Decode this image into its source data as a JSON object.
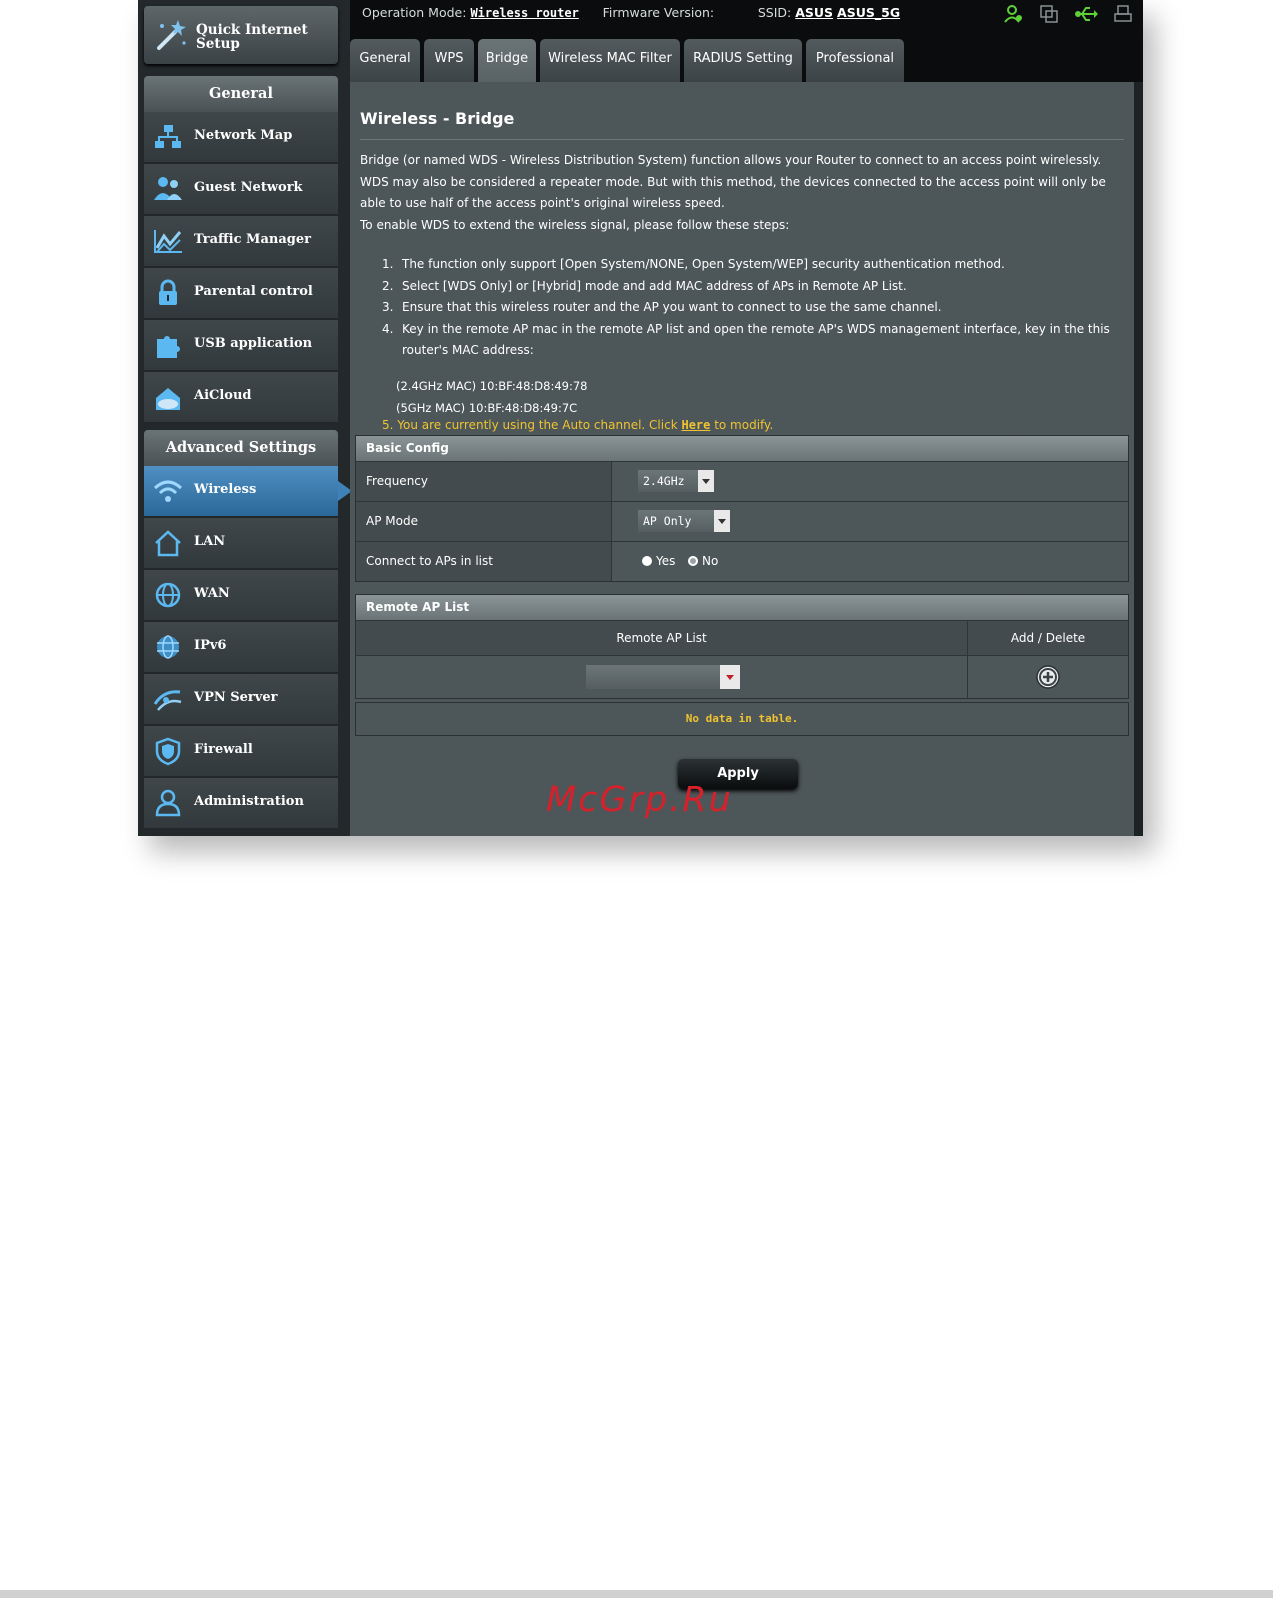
{
  "sidebar": {
    "quick_setup": "Quick Internet Setup",
    "general_header": "General",
    "general_items": [
      {
        "label": "Network Map",
        "icon": "network-map-icon"
      },
      {
        "label": "Guest Network",
        "icon": "guest-network-icon"
      },
      {
        "label": "Traffic Manager",
        "icon": "traffic-manager-icon"
      },
      {
        "label": "Parental control",
        "icon": "lock-icon"
      },
      {
        "label": "USB application",
        "icon": "puzzle-icon"
      },
      {
        "label": "AiCloud",
        "icon": "cloud-house-icon"
      }
    ],
    "advanced_header": "Advanced Settings",
    "advanced_items": [
      {
        "label": "Wireless",
        "icon": "wifi-icon",
        "active": true
      },
      {
        "label": "LAN",
        "icon": "house-icon"
      },
      {
        "label": "WAN",
        "icon": "globe-icon"
      },
      {
        "label": "IPv6",
        "icon": "ipv6-globe-icon"
      },
      {
        "label": "VPN Server",
        "icon": "vpn-icon"
      },
      {
        "label": "Firewall",
        "icon": "shield-icon"
      },
      {
        "label": "Administration",
        "icon": "user-icon"
      }
    ]
  },
  "topbar": {
    "op_mode_label": "Operation Mode:",
    "op_mode_value": "Wireless router",
    "firmware_label": "Firmware Version:",
    "ssid_label": "SSID:",
    "ssid_1": "ASUS",
    "ssid_2": "ASUS_5G"
  },
  "tabs": [
    {
      "label": "General"
    },
    {
      "label": "WPS"
    },
    {
      "label": "Bridge",
      "active": true
    },
    {
      "label": "Wireless MAC Filter"
    },
    {
      "label": "RADIUS Setting"
    },
    {
      "label": "Professional"
    }
  ],
  "content": {
    "title": "Wireless - Bridge",
    "description": "Bridge (or named WDS - Wireless Distribution System) function allows your Router to connect to an access point wirelessly. WDS may also be considered a repeater mode. But with this method, the devices connected to the access point will only be able to use half of the access point's original wireless speed.",
    "enable_intro": "To enable WDS to extend the wireless signal, please follow these steps:",
    "steps": [
      "The function only support [Open System/NONE, Open System/WEP] security authentication method.",
      "Select [WDS Only] or [Hybrid] mode and add MAC address of APs in Remote AP List.",
      "Ensure that this wireless router and the AP you want to connect to use the same channel.",
      "Key in the remote AP mac in the remote AP list and open the remote AP's WDS management interface, key in the this router's MAC address:"
    ],
    "mac_24": "(2.4GHz MAC) 10:BF:48:D8:49:78",
    "mac_5": "(5GHz MAC) 10:BF:48:D8:49:7C",
    "note_prefix": "5.  You are currently using the Auto channel. Click ",
    "note_link": "Here",
    "note_suffix": " to modify."
  },
  "basic_config": {
    "header": "Basic Config",
    "frequency_label": "Frequency",
    "frequency_value": "2.4GHz",
    "ap_mode_label": "AP Mode",
    "ap_mode_value": "AP Only",
    "connect_label": "Connect to APs in list",
    "yes_label": "Yes",
    "no_label": "No"
  },
  "remote_ap": {
    "header": "Remote AP List",
    "col_list": "Remote AP List",
    "col_add_delete": "Add / Delete",
    "empty": "No data in table."
  },
  "apply_label": "Apply",
  "watermark": "McGrp.Ru",
  "colors": {
    "accent_blue": "#3f82b7",
    "note_yellow": "#f0c330",
    "panel_bg": "#4d5659",
    "watermark_red": "#d6212b"
  }
}
